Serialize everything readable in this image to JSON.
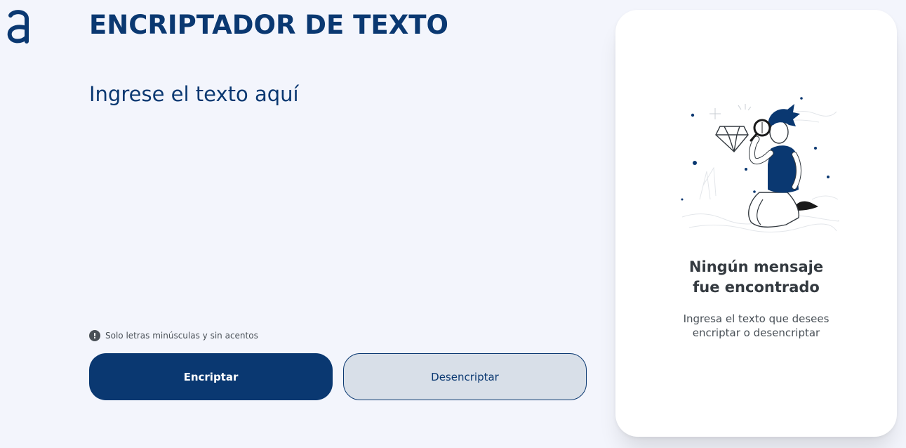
{
  "header": {
    "logo_icon": "alura-a-logo-icon",
    "title": "ENCRIPTADOR DE TEXTO"
  },
  "input": {
    "placeholder": "Ingrese el texto aquí",
    "value": ""
  },
  "hint": {
    "icon": "exclamation-circle-icon",
    "text": "Solo letras minúsculas y sin acentos"
  },
  "buttons": {
    "encrypt_label": "Encriptar",
    "decrypt_label": "Desencriptar"
  },
  "result_panel": {
    "illustration": "person-with-magnifying-glass-illustration",
    "title_line1": "Ningún mensaje",
    "title_line2": "fue encontrado",
    "text_line1": "Ingresa el texto que desees",
    "text_line2": "encriptar o desencriptar"
  },
  "colors": {
    "background": "#f3f5fc",
    "primary": "#0a3871",
    "secondary_button": "#d8dfe8",
    "panel": "#ffffff",
    "panel_title": "#343a40",
    "muted_text": "#495057"
  }
}
